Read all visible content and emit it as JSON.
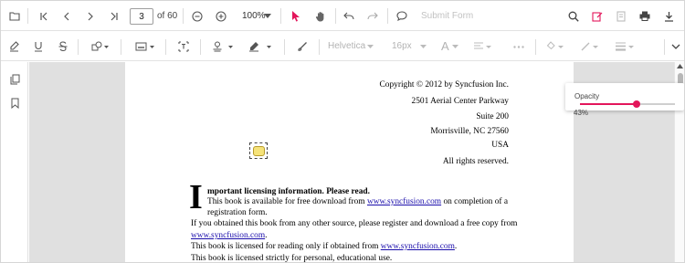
{
  "toolbar": {
    "page_number": "3",
    "page_of": "of 60",
    "zoom": "100%",
    "submit_form": "Submit Form"
  },
  "annotation_toolbar": {
    "font_family": "Helvetica",
    "font_size": "16px",
    "font_color_letter": "A"
  },
  "opacity_popup": {
    "label": "Opacity",
    "value_text": "43%",
    "value_fraction": 0.43
  },
  "colors": {
    "accent": "#e3165b",
    "viewer_bg": "#e0e0e0",
    "link": "#1a0dab"
  },
  "document": {
    "copyright": "Copyright © 2012 by Syncfusion Inc.",
    "address_1": "2501 Aerial Center Parkway",
    "address_2": "Suite 200",
    "address_3": "Morrisville, NC 27560",
    "address_4": "USA",
    "rights": "All rights reserved.",
    "dropcap": "I",
    "heading_rest": "mportant licensing information. Please read.",
    "p1_a": "This book is available for free download from ",
    "p1_link": "www.syncfusion.com",
    "p1_b": " on completion of a",
    "p1_c": "registration form.",
    "p2_a": "If you obtained this book from any other source, please register and download a free copy from",
    "p2_link": "www.syncfusion.com",
    "p2_b": ".",
    "p3_a": "This book is licensed for reading only if obtained from ",
    "p3_link": "www.syncfusion.com",
    "p3_b": ".",
    "p4": "This book is licensed strictly for personal, educational use."
  },
  "icons": [
    "folder-open-icon",
    "first-page-icon",
    "previous-page-icon",
    "next-page-icon",
    "last-page-icon",
    "zoom-out-icon",
    "zoom-in-icon",
    "chevron-down-icon",
    "select-pointer-icon",
    "pan-hand-icon",
    "undo-icon",
    "redo-icon",
    "comment-icon",
    "search-icon",
    "annotation-edit-icon",
    "form-designer-icon",
    "print-icon",
    "download-icon",
    "highlight-icon",
    "underline-icon",
    "strikethrough-icon",
    "shapes-icon",
    "calibrate-icon",
    "free-text-icon",
    "stamp-icon",
    "signature-icon",
    "ink-icon",
    "text-align-icon",
    "more-icon",
    "fill-color-icon",
    "stroke-color-icon",
    "thickness-icon",
    "collapse-icon",
    "thumbnails-icon",
    "bookmark-icon",
    "sticky-note-icon"
  ]
}
